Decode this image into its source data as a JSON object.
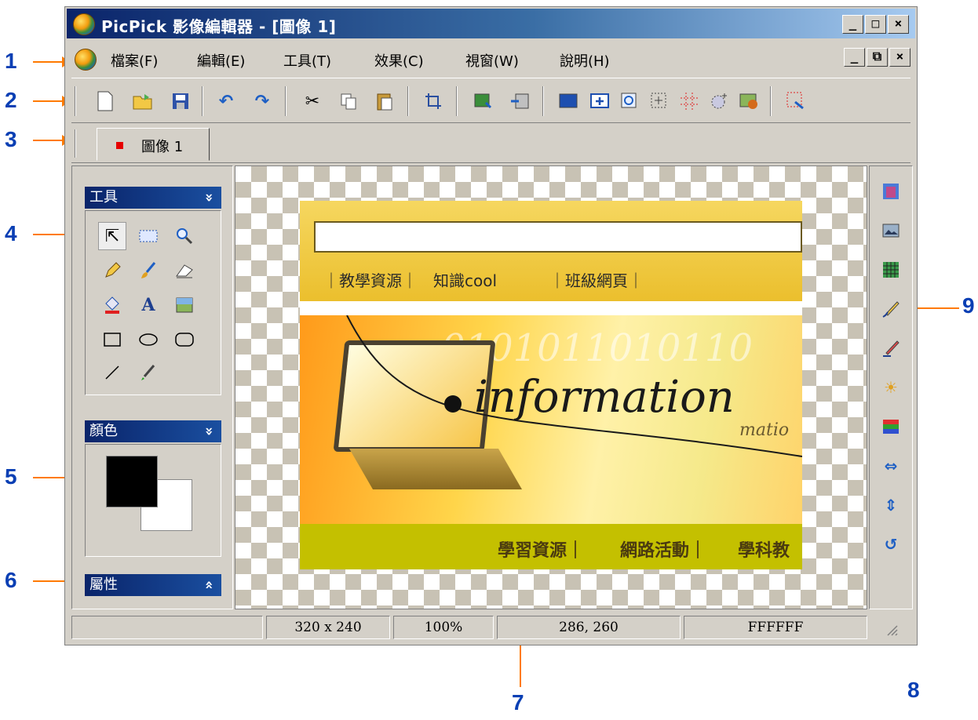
{
  "window": {
    "title": "PicPick 影像編輯器 - [圖像 1]",
    "caption_buttons": [
      "_",
      "□",
      "×"
    ],
    "mdi_buttons": [
      "_",
      "⧉",
      "×"
    ]
  },
  "menu": [
    "檔案(F)",
    "編輯(E)",
    "工具(T)",
    "效果(C)",
    "視窗(W)",
    "說明(H)"
  ],
  "toolbar_icons": [
    "new-icon",
    "open-icon",
    "save-icon",
    "undo-icon",
    "redo-icon",
    "cut-icon",
    "copy-icon",
    "paste-icon",
    "crop-icon",
    "import-icon",
    "export-icon",
    "fill-icon",
    "add-icon",
    "zoom-icon",
    "select-icon",
    "grid-icon",
    "magic-icon",
    "screen-icon",
    "capture-icon"
  ],
  "tabs": [
    {
      "label": "圖像 1"
    }
  ],
  "panels": {
    "tools": {
      "title": "工具",
      "chevron": "»"
    },
    "color": {
      "title": "顏色",
      "chevron": "»",
      "foreground": "#000000",
      "background": "#ffffff"
    },
    "properties": {
      "title": "屬性",
      "chevron": "«"
    }
  },
  "tool_glyphs": {
    "text": "A"
  },
  "image": {
    "nav": [
      "教學資源",
      "知識cool",
      "班級網頁"
    ],
    "headline": "information",
    "sub": "matio",
    "digits": "0101011010110",
    "bottom": [
      "學習資源",
      "網路活動",
      "學科教"
    ]
  },
  "status": {
    "empty": "",
    "size": "320 x 240",
    "zoom": "100%",
    "coords": "286, 260",
    "color": "FFFFFF"
  },
  "callouts": [
    "1",
    "2",
    "3",
    "4",
    "5",
    "6",
    "7",
    "8",
    "9"
  ]
}
